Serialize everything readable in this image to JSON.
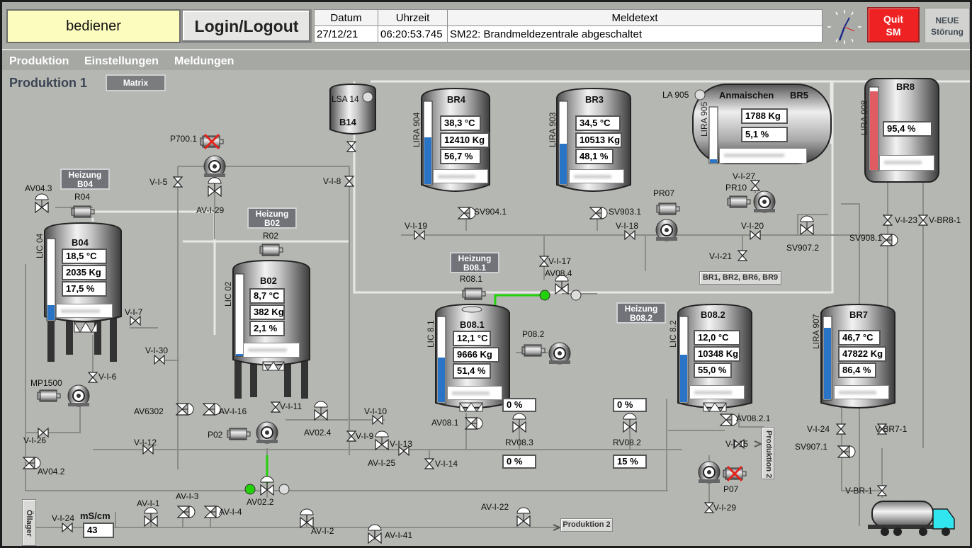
{
  "header": {
    "user": "bediener",
    "login_label": "Login/Logout",
    "columns": [
      "Datum",
      "Uhrzeit",
      "Meldetext"
    ],
    "message": {
      "date": "27/12/21",
      "time": "06:20:53.745",
      "text": "SM22: Brandmeldezentrale abgeschaltet"
    },
    "quit_label": [
      "Quit",
      "SM"
    ],
    "neu_label": [
      "NEUE",
      "Störung"
    ]
  },
  "menu": [
    "Produktion",
    "Einstellungen",
    "Meldungen"
  ],
  "page": {
    "title": "Produktion 1",
    "matrix_label": "Matrix"
  },
  "tanks": {
    "BR4": {
      "name": "BR4",
      "lira": "LIRA 904",
      "values": [
        "38,3 °C",
        "12410 Kg",
        "56,7 %"
      ],
      "level": 0.567
    },
    "BR3": {
      "name": "BR3",
      "lira": "LIRA 903",
      "values": [
        "34,5 °C",
        "10513 Kg",
        "48,1 %"
      ],
      "level": 0.481
    },
    "BR5": {
      "name": "BR5",
      "title": "Anmaischen",
      "la": "LA 905",
      "lira": "LIRA 905",
      "values": [
        "1788 Kg",
        "5,1 %"
      ],
      "level": 0.051
    },
    "BR8": {
      "name": "BR8",
      "lira": "LIRA 908",
      "values": [
        "95,4 %"
      ],
      "level": 0.954
    },
    "B04": {
      "name": "B04",
      "lic": "LIC 04",
      "values": [
        "18,5 °C",
        "2035 Kg",
        "17,5 %"
      ],
      "level": 0.175
    },
    "B02": {
      "name": "B02",
      "lic": "LIC 02",
      "values": [
        "8,7 °C",
        "382 Kg",
        "2,1 %"
      ],
      "level": 0.021
    },
    "B081": {
      "name": "B08.1",
      "lic": "LIC 8.1",
      "values": [
        "12,1 °C",
        "9666 Kg",
        "51,4 %"
      ],
      "level": 0.514
    },
    "B082": {
      "name": "B08.2",
      "lic": "LIC 8.2",
      "values": [
        "12,0 °C",
        "10348 Kg",
        "55,0 %"
      ],
      "level": 0.55
    },
    "BR7": {
      "name": "BR7",
      "lira": "LIRA 907",
      "values": [
        "46,7 °C",
        "47822 Kg",
        "86,4 %"
      ],
      "level": 0.864
    },
    "B14": {
      "name": "B14",
      "lsa": "LSA 14"
    }
  },
  "heizung": {
    "B04": [
      "Heizung",
      "B04"
    ],
    "B02": [
      "Heizung",
      "B02"
    ],
    "B081": [
      "Heizung",
      "B08.1"
    ],
    "B082": [
      "Heizung",
      "B08.2"
    ]
  },
  "percent_boxes": {
    "rv081_top": "0 %",
    "rv081_bottom": "0 %",
    "rv082_top": "0 %",
    "rv082_bottom": "15 %"
  },
  "conductivity": {
    "unit": "mS/cm",
    "value": "43"
  },
  "buttons": {
    "br_list": "BR1, BR2, BR6, BR9",
    "produktion2_h": "Produktion 2",
    "produktion2_v": "Produktion 2",
    "oellager": "Öllager"
  },
  "labels": {
    "AV04_3": "AV04.3",
    "R04": "R04",
    "P700_1": "P700.1",
    "VI5": "V-I-5",
    "AVI29": "AV-I-29",
    "R02": "R02",
    "VI8": "V-I-8",
    "SV904_1": "SV904.1",
    "SV903_1": "SV903.1",
    "PR07": "PR07",
    "PR10": "PR10",
    "VI27": "V-I-27",
    "VI19": "V-I-19",
    "VI18": "V-I-18",
    "VI20": "V-I-20",
    "VI21": "V-I-21",
    "SV907_2": "SV907.2",
    "VI23": "V-I-23",
    "VBR8_1": "V-BR8-1",
    "SV908_1": "SV908.1",
    "VI17": "V-I-17",
    "AV08_4": "AV08.4",
    "R08_1": "R08.1",
    "VI7": "V-I-7",
    "VI30": "V-I-30",
    "VI6": "V-I-6",
    "MP1500": "MP1500",
    "AV6302": "AV6302",
    "AVI16": "AV-I-16",
    "VI11": "V-I-11",
    "VI26": "V-I-26",
    "VI12": "V-I-12",
    "P02": "P02",
    "AV02_4": "AV02.4",
    "VI10": "V-I-10",
    "VI9": "V-I-9",
    "VI13": "V-I-13",
    "AVI25": "AV-I-25",
    "VI14": "V-I-14",
    "AV04_2": "AV04.2",
    "P08_2": "P08.2",
    "AV08_1": "AV08.1",
    "RV08_3": "RV08.3",
    "RV08_2": "RV08.2",
    "AV08_2_1": "AV08.2.1",
    "VI15": "V-I-15",
    "P07": "P07",
    "VI29": "V-I-29",
    "VI24": "V-I-24",
    "SV907_1": "SV907.1",
    "VBR7_1": "V-BR7-1",
    "VBR1": "V-BR-1",
    "AV02_2": "AV02.2",
    "AVI1": "AV-I-1",
    "AVI3": "AV-I-3",
    "AVI4": "AV-I-4",
    "AVI2": "AV-I-2",
    "AVI41": "AV-I-41",
    "AVI22": "AV-I-22",
    "VI24b": "V-I-24"
  },
  "colors": {
    "background": "#b5b7b2",
    "pipe": "#e6e6e4",
    "level": "#2a74c7",
    "level_high": "#e15b63",
    "active": "#22d10a",
    "alarm": "#e2221b"
  }
}
